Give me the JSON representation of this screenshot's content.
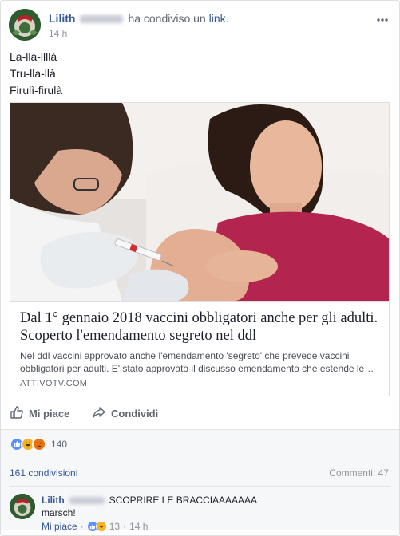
{
  "post": {
    "author": "Lilith",
    "action": "ha condiviso un",
    "link_word": "link.",
    "time": "14 h",
    "more_icon": "more-icon",
    "text_lines": [
      "La-lla-llllà",
      "Tru-lla-llà",
      "Firulì-firulà"
    ]
  },
  "preview": {
    "title": "Dal 1° gennaio 2018 vaccini obbligatori anche per gli adulti. Scoperto l'emendamento segreto nel ddl",
    "description": "Nel ddl vaccini approvato anche l'emendamento 'segreto' che prevede vaccini obbligatori per adulti. E' stato approvato il discusso emendamento che estende le…",
    "domain": "ATTIVOTV.COM"
  },
  "actions": {
    "like": "Mi piace",
    "share": "Condividi"
  },
  "stats": {
    "reactions_count": "140",
    "shares": "161 condivisioni",
    "comments": "Commenti: 47"
  },
  "comment": {
    "author": "Lilith",
    "text_line1": "SCOPRIRE LE BRACCIAAAAAAA",
    "text_line2": "marsch!",
    "like": "Mi piace",
    "reaction_count": "13",
    "time": "14 h"
  },
  "colors": {
    "link_blue": "#365899",
    "meta_gray": "#90949c",
    "like_blue": "#5890ff",
    "haha_yellow": "#f7b125",
    "angry_orange": "#e9710f"
  }
}
